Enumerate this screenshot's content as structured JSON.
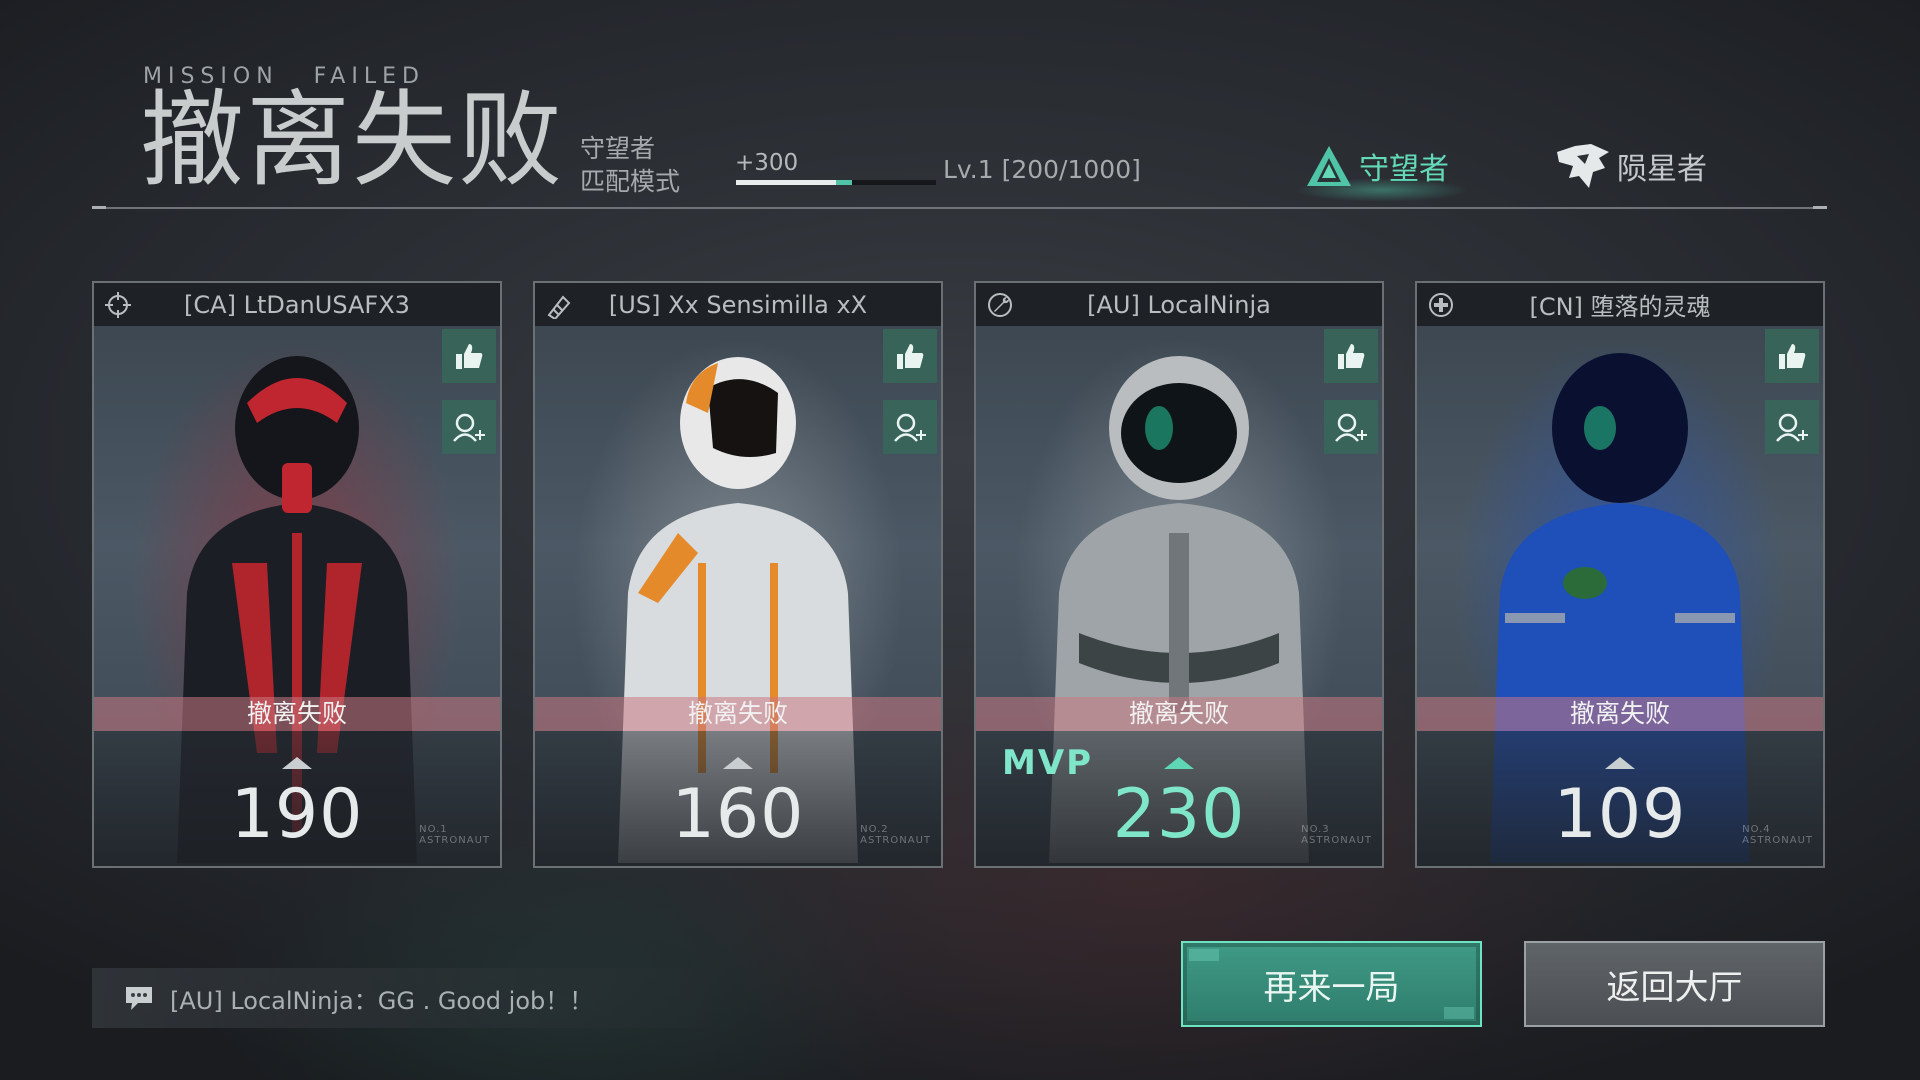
{
  "header": {
    "subtitle": "MISSION   FAILED",
    "title": "撤离失败",
    "mode_line1": "守望者",
    "mode_line2": "匹配模式",
    "xp_gain": "+300",
    "xp_progress": 0.5,
    "xp_gain_fraction": 0.08,
    "level": "Lv.1  [200/1000]"
  },
  "factions": [
    {
      "name": "守望者",
      "icon": "watcher-triangle-icon",
      "active": true
    },
    {
      "name": "陨星者",
      "icon": "meteor-wolf-icon",
      "active": false
    }
  ],
  "players": [
    {
      "name": "[CA] LtDanUSAFX3",
      "role_icon": "crosshair-icon",
      "status": "撤离失败",
      "score": "190",
      "mvp": false,
      "number": "NO.1\nASTRONAUT"
    },
    {
      "name": "[US] Xx Sensimilla xX",
      "role_icon": "ammo-icon",
      "status": "撤离失败",
      "score": "160",
      "mvp": false,
      "number": "NO.2\nASTRONAUT"
    },
    {
      "name": "[AU] LocalNinja",
      "role_icon": "wrench-icon",
      "status": "撤离失败",
      "score": "230",
      "mvp": true,
      "mvp_label": "MVP",
      "number": "NO.3\nASTRONAUT"
    },
    {
      "name": "[CN] 堕落的灵魂",
      "role_icon": "medic-cross-icon",
      "status": "撤离失败",
      "score": "109",
      "mvp": false,
      "number": "NO.4\nASTRONAUT"
    }
  ],
  "chat": {
    "icon": "chat-bubble-icon",
    "message": "[AU] LocalNinja：GG . Good job！！"
  },
  "buttons": {
    "again": "再来一局",
    "lobby": "返回大厅"
  },
  "colors": {
    "accent": "#4fc4a6",
    "mvp": "#7fe6ca",
    "fail_band": "#c8788a"
  }
}
